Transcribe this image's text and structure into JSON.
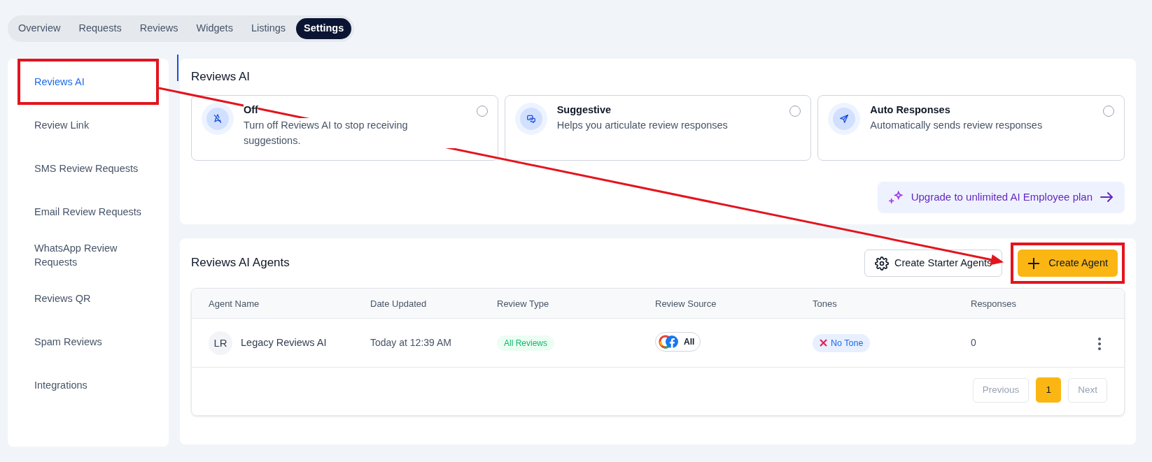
{
  "tabs": [
    {
      "label": "Overview",
      "selected": false
    },
    {
      "label": "Requests",
      "selected": false
    },
    {
      "label": "Reviews",
      "selected": false
    },
    {
      "label": "Widgets",
      "selected": false
    },
    {
      "label": "Listings",
      "selected": false
    },
    {
      "label": "Settings",
      "selected": true
    }
  ],
  "sidebar": {
    "items": [
      {
        "label": "Reviews AI",
        "selected": true,
        "highlighted": true
      },
      {
        "label": "Review Link",
        "selected": false,
        "highlighted": false
      },
      {
        "label": "SMS Review Requests",
        "selected": false,
        "highlighted": false
      },
      {
        "label": "Email Review Requests",
        "selected": false,
        "highlighted": false
      },
      {
        "label": "WhatsApp Review Requests",
        "selected": false,
        "highlighted": false
      },
      {
        "label": "Reviews QR",
        "selected": false,
        "highlighted": false
      },
      {
        "label": "Spam Reviews",
        "selected": false,
        "highlighted": false
      },
      {
        "label": "Integrations",
        "selected": false,
        "highlighted": false
      }
    ]
  },
  "reviews_ai": {
    "title": "Reviews AI",
    "modes": [
      {
        "kind": "off",
        "title": "Off",
        "description": "Turn off Reviews AI to stop receiving suggestions.",
        "selected": false
      },
      {
        "kind": "suggestive",
        "title": "Suggestive",
        "description": "Helps you articulate review responses",
        "selected": false
      },
      {
        "kind": "auto",
        "title": "Auto Responses",
        "description": "Automatically sends review responses",
        "selected": false
      }
    ],
    "upgrade_button": "Upgrade to unlimited AI Employee plan"
  },
  "agents": {
    "title": "Reviews AI Agents",
    "starter_button": {
      "label": "Create Starter Agents",
      "highlighted": false
    },
    "create_button": {
      "label": "Create Agent",
      "highlighted": true
    },
    "table": {
      "columns": [
        "Agent Name",
        "Date Updated",
        "Review Type",
        "Review Source",
        "Tones",
        "Responses"
      ],
      "rows": [
        {
          "initials": "LR",
          "name": "Legacy Reviews AI",
          "date": "Today at 12:39 AM",
          "review_type": "All Reviews",
          "source": "All",
          "tone": "No Tone",
          "responses": "0"
        }
      ]
    },
    "pagination": {
      "previous": {
        "label": "Previous",
        "disabled": true
      },
      "pages": [
        {
          "label": "1",
          "selected": true
        }
      ],
      "next": {
        "label": "Next",
        "disabled": true
      }
    }
  },
  "annotation": {
    "arrow": true
  }
}
